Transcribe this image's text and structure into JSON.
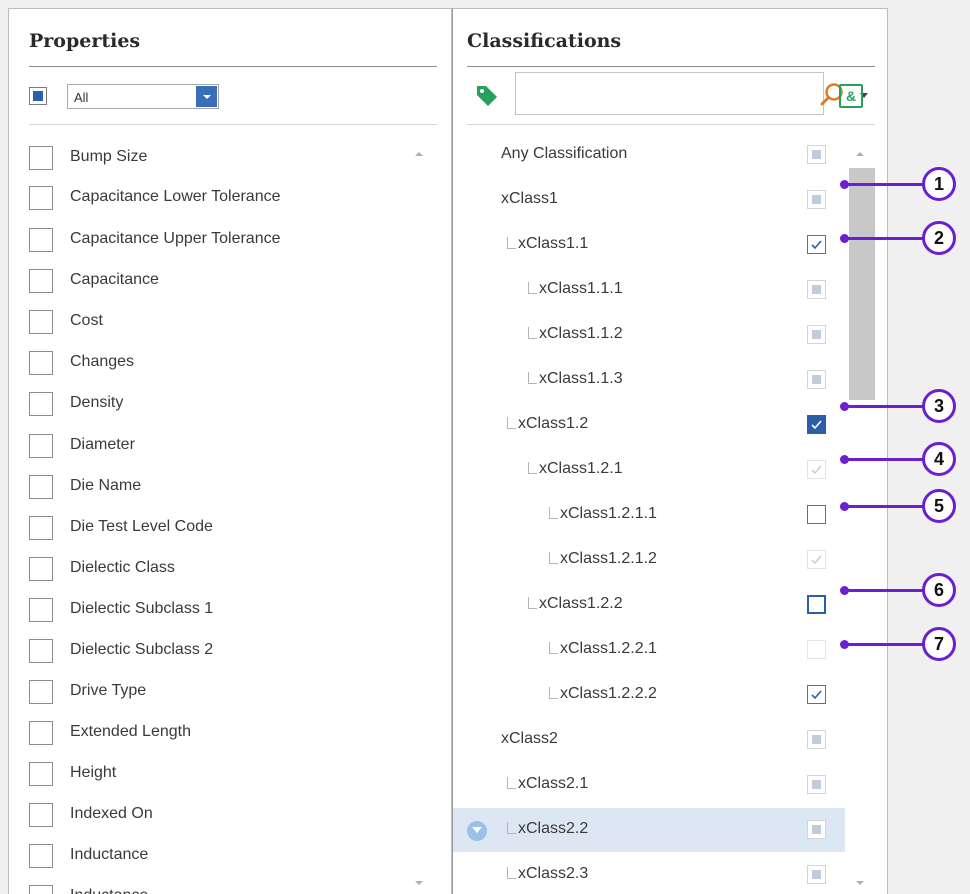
{
  "properties": {
    "title": "Properties",
    "filter_value": "All",
    "items": [
      "Bump Size",
      "Capacitance Lower Tolerance",
      "Capacitance Upper Tolerance",
      "Capacitance",
      "Cost",
      "Changes",
      "Density",
      "Diameter",
      "Die Name",
      "Die Test Level Code",
      "Dielectic Class",
      "Dielectic Subclass 1",
      "Dielectic Subclass 2",
      "Drive Type",
      "Extended Length",
      "Height",
      "Indexed On",
      "Inductance",
      "Inductance ..."
    ]
  },
  "classifications": {
    "title": "Classifications",
    "search_value": "",
    "search_button_label": "&",
    "tree": [
      {
        "label": "Any Classification",
        "state": "partial"
      },
      {
        "label": "xClass1",
        "state": "partial"
      },
      {
        "label": "xClass1.1",
        "state": "checked"
      },
      {
        "label": "xClass1.1.1",
        "state": "partial"
      },
      {
        "label": "xClass1.1.2",
        "state": "partial"
      },
      {
        "label": "xClass1.1.3",
        "state": "partial"
      },
      {
        "label": "xClass1.2",
        "state": "checked-highlighted"
      },
      {
        "label": "xClass1.2.1",
        "state": "checked-dimmed"
      },
      {
        "label": "xClass1.2.1.1",
        "state": "unchecked"
      },
      {
        "label": "xClass1.2.1.2",
        "state": "checked-dimmed"
      },
      {
        "label": "xClass1.2.2",
        "state": "unchecked-focused"
      },
      {
        "label": "xClass1.2.2.1",
        "state": "unchecked-dimmed"
      },
      {
        "label": "xClass1.2.2.2",
        "state": "checked"
      },
      {
        "label": "xClass2",
        "state": "partial"
      },
      {
        "label": "xClass2.1",
        "state": "partial"
      },
      {
        "label": "xClass2.2",
        "state": "partial",
        "selected": true,
        "filter_icon": "funnel-icon"
      },
      {
        "label": "xClass2.3",
        "state": "partial"
      }
    ]
  },
  "callouts": [
    "1",
    "2",
    "3",
    "4",
    "5",
    "6",
    "7"
  ],
  "colors": {
    "accent": "#2d5fa8",
    "callout": "#6a1fd0",
    "tag": "#27a05f",
    "search_icon": "#e07b1f",
    "selected_row": "#dde6f3"
  }
}
